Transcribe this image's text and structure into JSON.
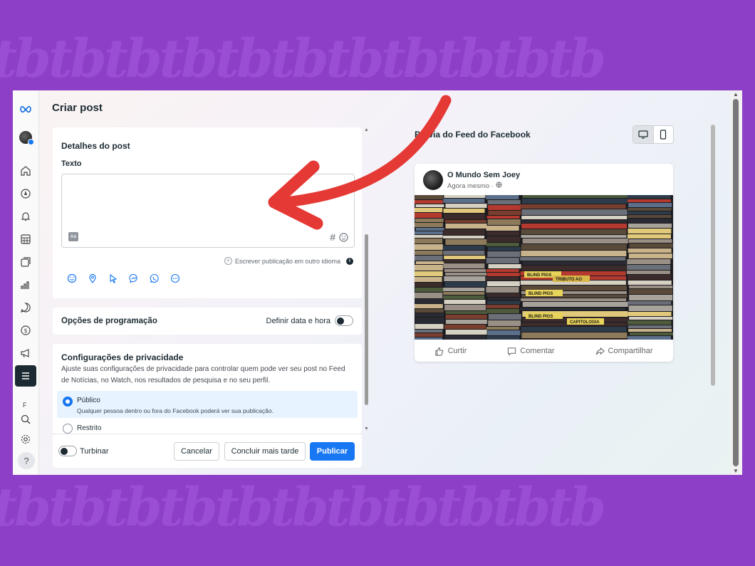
{
  "page": {
    "title": "Criar post"
  },
  "rail": {
    "section_letter": "F",
    "help": "?",
    "icons": [
      "meta-logo-icon",
      "page-avatar",
      "home-icon",
      "compass-icon",
      "notifications-icon",
      "calendar-grid-icon",
      "content-library-icon",
      "insights-icon",
      "inbox-icon",
      "monetization-icon",
      "ads-icon",
      "all-tools-menu-icon",
      "search-icon",
      "settings-icon",
      "help-icon"
    ]
  },
  "details": {
    "title": "Detalhes do post",
    "text_label": "Texto",
    "text_value": "",
    "text_tool": "Aa",
    "hashtag": "#",
    "other_language": "Escrever publicação em outro idioma",
    "info": "i",
    "tools": [
      "emoji-icon",
      "location-icon",
      "pointer-icon",
      "messenger-icon",
      "whatsapp-icon",
      "more-icon"
    ]
  },
  "schedule": {
    "title": "Opções de programação",
    "toggle_label": "Definir data e hora",
    "enabled": false
  },
  "privacy": {
    "title": "Configurações de privacidade",
    "description": "Ajuste suas configurações de privacidade para controlar quem pode ver seu post no Feed de Notícias, no Watch, nos resultados de pesquisa e no seu perfil.",
    "options": [
      {
        "label": "Público",
        "sub": "Qualquer pessoa dentro ou fora do Facebook poderá ver sua publicação.",
        "selected": true
      },
      {
        "label": "Restrito",
        "sub": "",
        "selected": false
      }
    ]
  },
  "footer": {
    "boost_label": "Turbinar",
    "boost_enabled": false,
    "cancel": "Cancelar",
    "later": "Concluir mais tarde",
    "publish": "Publicar"
  },
  "preview": {
    "title": "Prévia do Feed do Facebook",
    "devices": [
      "desktop-icon",
      "mobile-icon"
    ],
    "selected_device": "desktop",
    "card": {
      "page_name": "O Mundo Sem Joey",
      "time": "Agora mesmo ·",
      "image_text": [
        "BLIND PIGS",
        "TRIBUTO AO",
        "BLIND PIGS",
        "BLIND PIGS",
        "CAPITOLOGIA"
      ],
      "actions": {
        "like": "Curtir",
        "comment": "Comentar",
        "share": "Compartilhar"
      }
    }
  },
  "colors": {
    "background": "#8e3fc8",
    "accent": "#1877f2",
    "annotation_arrow": "#e53935",
    "dark": "#1c2b33"
  }
}
